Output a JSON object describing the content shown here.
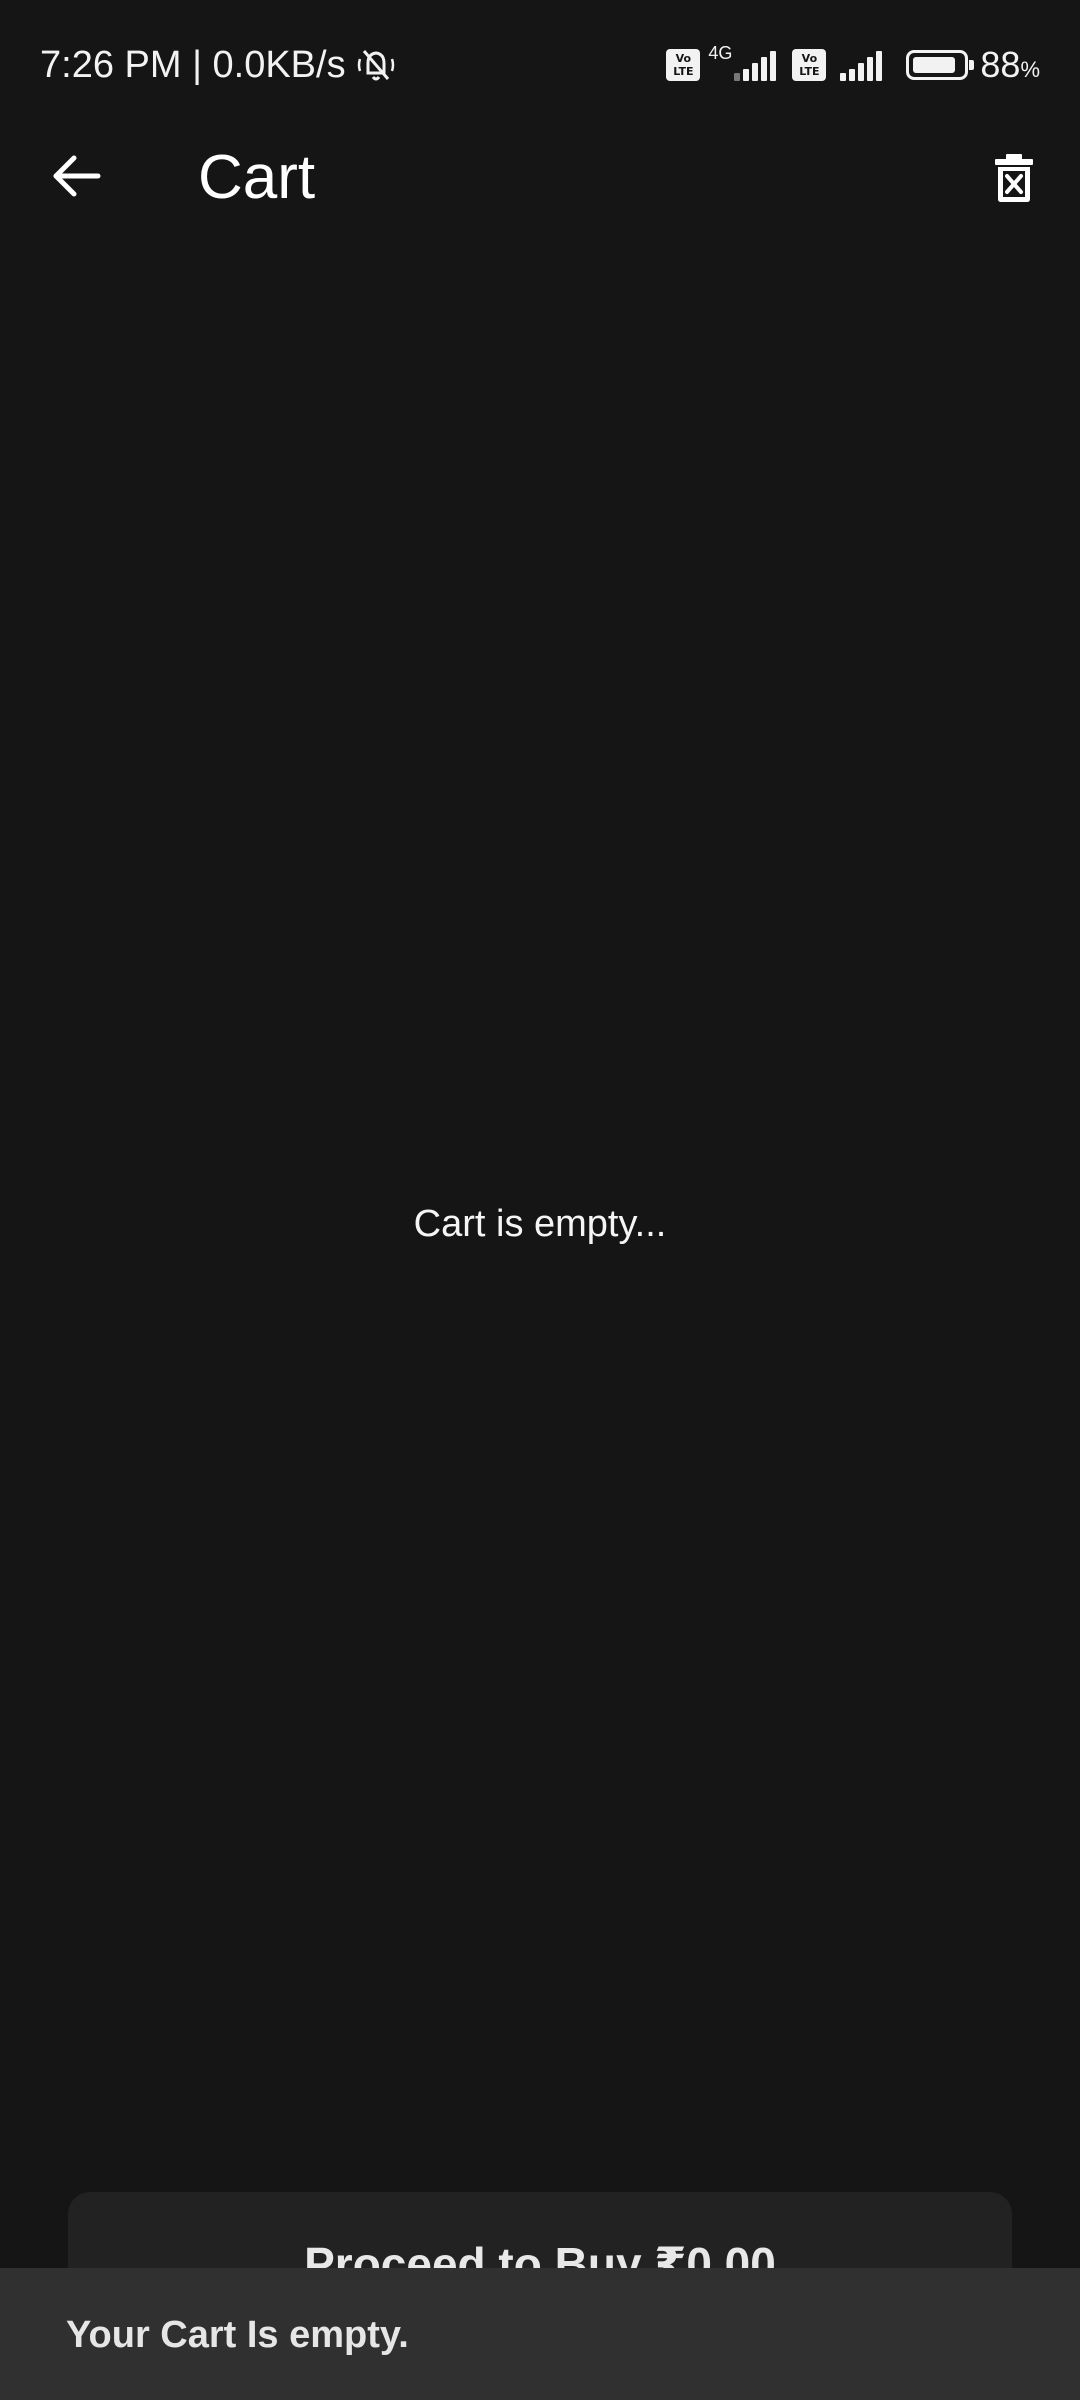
{
  "status_bar": {
    "time_speed": "7:26 PM | 0.0KB/s",
    "sim1_badge_top": "Vo",
    "sim1_badge_bottom": "LTE",
    "network_type": "4G",
    "sim2_badge_top": "Vo",
    "sim2_badge_bottom": "LTE",
    "battery_percent": "88",
    "battery_percent_sign": "%",
    "battery_level": 0.88
  },
  "app_bar": {
    "title": "Cart",
    "back_icon": "arrow-left-icon",
    "clear_icon": "delete-x-icon"
  },
  "main": {
    "empty_message": "Cart is empty..."
  },
  "footer": {
    "proceed_label": "Proceed to Buy ₹0.00"
  },
  "snackbar": {
    "message": "Your Cart Is empty."
  },
  "colors": {
    "background": "#151515",
    "button_bg": "#222222",
    "snackbar_bg": "#303030",
    "text": "#ffffff"
  }
}
